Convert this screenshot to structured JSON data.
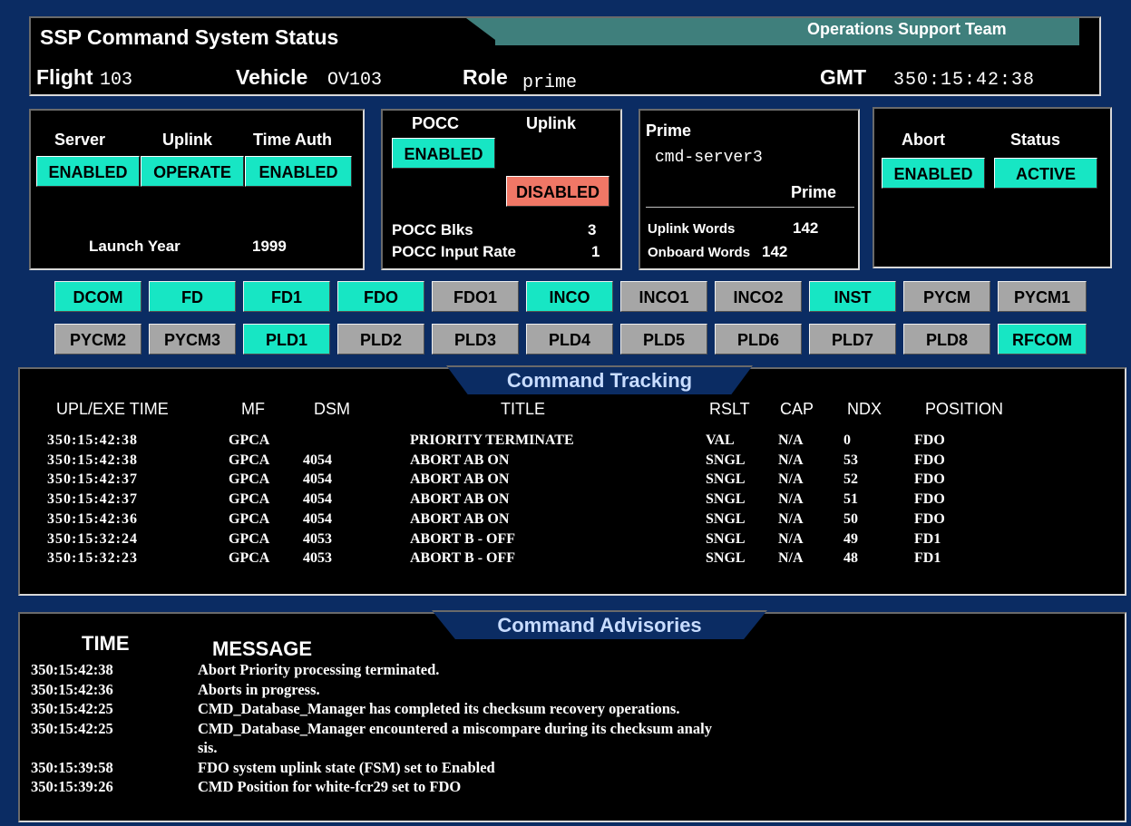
{
  "header": {
    "title": "SSP Command System Status",
    "team": "Operations Support Team",
    "flight_label": "Flight",
    "flight_value": "103",
    "vehicle_label": "Vehicle",
    "vehicle_value": "OV103",
    "role_label": "Role",
    "role_value": "prime",
    "gmt_label": "GMT",
    "gmt_value": "350:15:42:38"
  },
  "status_panel": {
    "server_label": "Server",
    "server_value": "ENABLED",
    "uplink_label": "Uplink",
    "uplink_value": "OPERATE",
    "time_auth_label": "Time Auth",
    "time_auth_value": "ENABLED",
    "launch_year_label": "Launch Year",
    "launch_year_value": "1999"
  },
  "pocc_panel": {
    "pocc_label": "POCC",
    "pocc_value": "ENABLED",
    "uplink_label": "Uplink",
    "uplink_value": "DISABLED",
    "blks_label": "POCC Blks",
    "blks_value": "3",
    "rate_label": "POCC Input Rate",
    "rate_value": "1"
  },
  "prime_panel": {
    "prime_label": "Prime",
    "server_name": "cmd-server3",
    "role_value": "Prime",
    "uplink_words_label": "Uplink Words",
    "uplink_words_value": "142",
    "onboard_words_label": "Onboard Words",
    "onboard_words_value": "142"
  },
  "abort_panel": {
    "abort_label": "Abort",
    "abort_value": "ENABLED",
    "status_label": "Status",
    "status_value": "ACTIVE"
  },
  "colors": {
    "background": "#0b2c63",
    "enabled": "#17e6c4",
    "disabled": "#f07766",
    "inactive": "#a6a6a6"
  },
  "positions_row1": [
    {
      "label": "DCOM",
      "active": true
    },
    {
      "label": "FD",
      "active": true
    },
    {
      "label": "FD1",
      "active": true
    },
    {
      "label": "FDO",
      "active": true
    },
    {
      "label": "FDO1",
      "active": false
    },
    {
      "label": "INCO",
      "active": true
    },
    {
      "label": "INCO1",
      "active": false
    },
    {
      "label": "INCO2",
      "active": false
    },
    {
      "label": "INST",
      "active": true
    },
    {
      "label": "PYCM",
      "active": false
    },
    {
      "label": "PYCM1",
      "active": false
    }
  ],
  "positions_row2": [
    {
      "label": "PYCM2",
      "active": false
    },
    {
      "label": "PYCM3",
      "active": false
    },
    {
      "label": "PLD1",
      "active": true
    },
    {
      "label": "PLD2",
      "active": false
    },
    {
      "label": "PLD3",
      "active": false
    },
    {
      "label": "PLD4",
      "active": false
    },
    {
      "label": "PLD5",
      "active": false
    },
    {
      "label": "PLD6",
      "active": false
    },
    {
      "label": "PLD7",
      "active": false
    },
    {
      "label": "PLD8",
      "active": false
    },
    {
      "label": "RFCOM",
      "active": true
    }
  ],
  "tracking": {
    "title": "Command Tracking",
    "headers": {
      "time": "UPL/EXE TIME",
      "mf": "MF",
      "dsm": "DSM",
      "title": "TITLE",
      "rslt": "RSLT",
      "cap": "CAP",
      "ndx": "NDX",
      "position": "POSITION"
    },
    "rows": [
      {
        "time": "350:15:42:38",
        "mf": "GPCA",
        "dsm": "",
        "title": "PRIORITY TERMINATE",
        "rslt": "VAL",
        "cap": "N/A",
        "ndx": "0",
        "position": "FDO"
      },
      {
        "time": "350:15:42:38",
        "mf": "GPCA",
        "dsm": "4054",
        "title": "ABORT AB ON",
        "rslt": "SNGL",
        "cap": "N/A",
        "ndx": "53",
        "position": "FDO"
      },
      {
        "time": "350:15:42:37",
        "mf": "GPCA",
        "dsm": "4054",
        "title": "ABORT AB ON",
        "rslt": "SNGL",
        "cap": "N/A",
        "ndx": "52",
        "position": "FDO"
      },
      {
        "time": "350:15:42:37",
        "mf": "GPCA",
        "dsm": "4054",
        "title": "ABORT AB ON",
        "rslt": "SNGL",
        "cap": "N/A",
        "ndx": "51",
        "position": "FDO"
      },
      {
        "time": "350:15:42:36",
        "mf": "GPCA",
        "dsm": "4054",
        "title": "ABORT AB ON",
        "rslt": "SNGL",
        "cap": "N/A",
        "ndx": "50",
        "position": "FDO"
      },
      {
        "time": "350:15:32:24",
        "mf": "GPCA",
        "dsm": "4053",
        "title": "ABORT B - OFF",
        "rslt": "SNGL",
        "cap": "N/A",
        "ndx": "49",
        "position": "FD1"
      },
      {
        "time": "350:15:32:23",
        "mf": "GPCA",
        "dsm": "4053",
        "title": "ABORT B - OFF",
        "rslt": "SNGL",
        "cap": "N/A",
        "ndx": "48",
        "position": "FD1"
      }
    ]
  },
  "advisories": {
    "title": "Command Advisories",
    "time_header": "TIME",
    "message_header": "MESSAGE",
    "rows": [
      {
        "time": "350:15:42:38",
        "message": "Abort Priority processing terminated."
      },
      {
        "time": "350:15:42:36",
        "message": "Aborts in progress."
      },
      {
        "time": "350:15:42:25",
        "message": "CMD_Database_Manager has completed its checksum recovery operations."
      },
      {
        "time": "350:15:42:25",
        "message": "CMD_Database_Manager encountered a miscompare during its checksum analy"
      },
      {
        "time": "",
        "message": "sis."
      },
      {
        "time": "350:15:39:58",
        "message": "FDO system uplink state (FSM) set to Enabled"
      },
      {
        "time": "350:15:39:26",
        "message": "CMD Position for white-fcr29 set to FDO"
      }
    ]
  }
}
